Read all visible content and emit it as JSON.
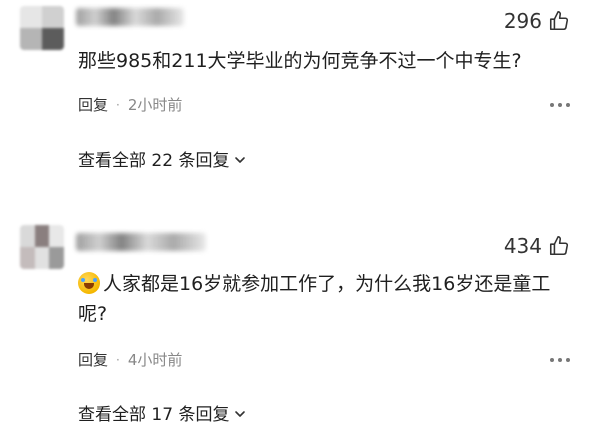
{
  "comments": [
    {
      "likes": "296",
      "text": "那些985和211大学毕业的为何竞争不过一个中专生?",
      "reply_label": "回复",
      "separator": "·",
      "time": "2小时前",
      "view_replies": "查看全部 22 条回复"
    },
    {
      "likes": "434",
      "text": "人家都是16岁就参加工作了，为什么我16岁还是童工呢?",
      "reply_label": "回复",
      "separator": "·",
      "time": "4小时前",
      "view_replies": "查看全部 17 条回复"
    }
  ],
  "icons": {
    "like": "thumbs-up-icon",
    "more": "more-dots-icon",
    "expand": "chevron-down-icon",
    "emoji": "laughing-crying-emoji"
  },
  "colors": {
    "text": "#1f1f1f",
    "muted": "#888888",
    "background": "#ffffff"
  }
}
